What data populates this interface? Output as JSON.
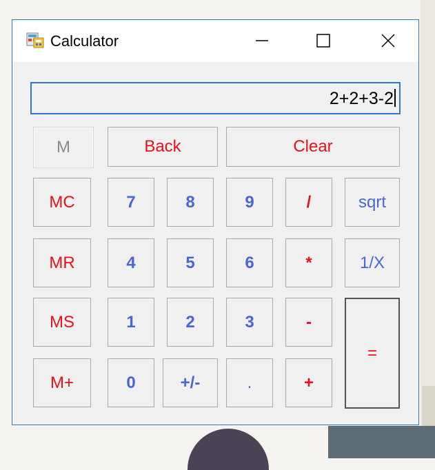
{
  "window": {
    "title": "Calculator",
    "icon": "calculator-app-icon"
  },
  "titlebar_buttons": [
    "minimize-icon",
    "maximize-icon",
    "close-icon"
  ],
  "display": {
    "value": "2+2+3-2"
  },
  "keys": {
    "m": "M",
    "back": "Back",
    "clear": "Clear",
    "mc": "MC",
    "mr": "MR",
    "ms": "MS",
    "mplus": "M+",
    "d7": "7",
    "d8": "8",
    "d9": "9",
    "d4": "4",
    "d5": "5",
    "d6": "6",
    "d1": "1",
    "d2": "2",
    "d3": "3",
    "d0": "0",
    "sign": "+/-",
    "dot": ".",
    "div": "/",
    "mul": "*",
    "sub": "-",
    "add": "+",
    "sqrt": "sqrt",
    "recip": "1/X",
    "eq": "="
  },
  "colors": {
    "accent_border": "#2b79c6",
    "operator_red": "#e8101d",
    "digit_blue": "#4a65d4"
  }
}
